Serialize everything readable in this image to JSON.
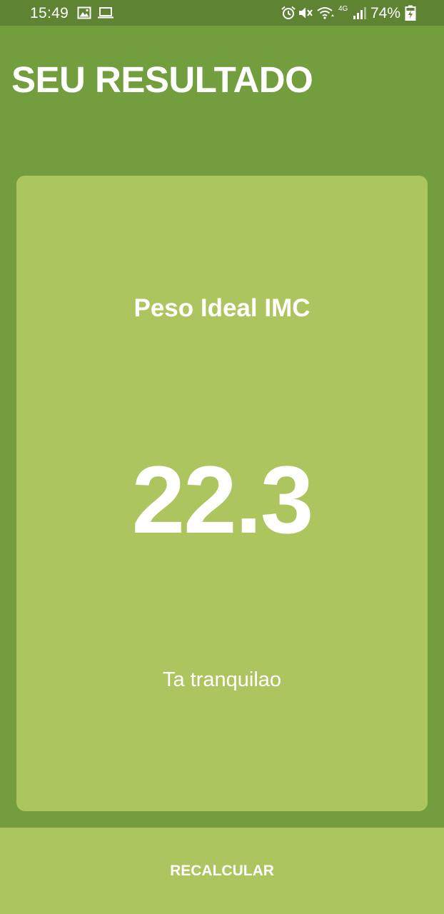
{
  "status_bar": {
    "time": "15:49",
    "battery_percent": "74%",
    "network_type": "4G",
    "icons": [
      "image-icon",
      "laptop-icon",
      "alarm-icon",
      "mute-icon",
      "wifi-icon",
      "signal-icon",
      "battery-charging-icon"
    ]
  },
  "header": {
    "title": "SEU RESULTADO"
  },
  "result": {
    "label": "Peso Ideal IMC",
    "value": "22.3",
    "message": "Ta tranquilao"
  },
  "actions": {
    "recalculate_label": "RECALCULAR"
  },
  "colors": {
    "background": "#729e3e",
    "status_bar": "#5e8433",
    "card": "#adc55f",
    "text": "#ffffff"
  }
}
